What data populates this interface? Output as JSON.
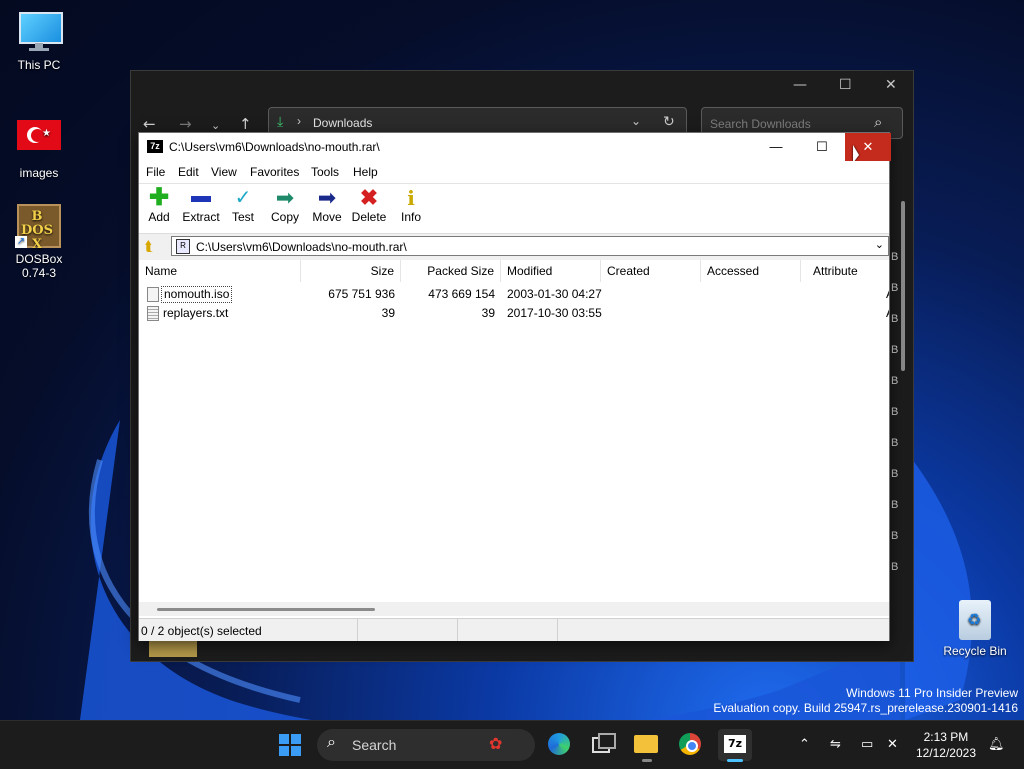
{
  "desktop": {
    "icons": [
      {
        "label": "This PC"
      },
      {
        "label": "images"
      },
      {
        "label": "DOSBox 0.74-3"
      },
      {
        "label": "Recycle Bin"
      }
    ],
    "watermark_line1": "Windows 11 Pro Insider Preview",
    "watermark_line2": "Evaluation copy. Build 25947.rs_prerelease.230901-1416"
  },
  "explorer": {
    "address_folder": "Downloads",
    "search_placeholder": "Search Downloads",
    "size_suffix": "B"
  },
  "zip_window": {
    "title": "C:\\Users\\vm6\\Downloads\\no-mouth.rar\\",
    "menu": [
      "File",
      "Edit",
      "View",
      "Favorites",
      "Tools",
      "Help"
    ],
    "toolbar": [
      "Add",
      "Extract",
      "Test",
      "Copy",
      "Move",
      "Delete",
      "Info"
    ],
    "path": "C:\\Users\\vm6\\Downloads\\no-mouth.rar\\",
    "columns": [
      "Name",
      "Size",
      "Packed Size",
      "Modified",
      "Created",
      "Accessed",
      "Attribute"
    ],
    "files": [
      {
        "name": "nomouth.iso",
        "size": "675 751 936",
        "packed": "473 669 154",
        "modified": "2003-01-30 04:27",
        "attr": "A"
      },
      {
        "name": "replayers.txt",
        "size": "39",
        "packed": "39",
        "modified": "2017-10-30 03:55",
        "attr": "A"
      }
    ],
    "status": "0 / 2 object(s) selected"
  },
  "taskbar": {
    "search_label": "Search",
    "time": "2:13 PM",
    "date": "12/12/2023"
  },
  "colors": {
    "close_hover": "#c42b1c",
    "add_green": "#1fae1f",
    "delete_red": "#d42020",
    "taskbar_bg": "#1c1c1c"
  }
}
